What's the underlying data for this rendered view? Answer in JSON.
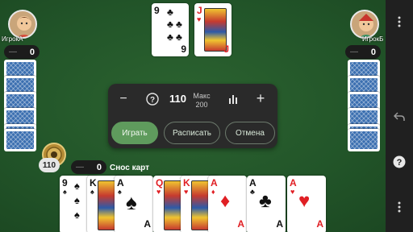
{
  "players": {
    "left": {
      "name": "ИгрокА",
      "score": "0",
      "dash": "—"
    },
    "right": {
      "name": "ИгрокБ",
      "score": "0",
      "dash": "—"
    },
    "me": {
      "score": "0",
      "dash": "—",
      "bid_badge": "110"
    }
  },
  "talon": {
    "cards": [
      {
        "rank": "9",
        "suit": "♣",
        "color": "black"
      },
      {
        "rank": "J",
        "suit": "♥",
        "color": "red"
      }
    ]
  },
  "bid_panel": {
    "minus": "−",
    "help": "?",
    "bid_value": "110",
    "max_label": "Макс",
    "max_value": "200",
    "stats": "stats-icon",
    "plus": "+",
    "buttons": {
      "play": "Играть",
      "write_off": "Расписать",
      "cancel": "Отмена"
    }
  },
  "trash_label": "Снос карт",
  "hand": [
    {
      "rank": "9",
      "suit": "♠",
      "color": "black"
    },
    {
      "rank": "K",
      "suit": "♠",
      "color": "black"
    },
    {
      "rank": "A",
      "suit": "♠",
      "color": "black"
    },
    {
      "rank": "Q",
      "suit": "♥",
      "color": "red"
    },
    {
      "rank": "K",
      "suit": "♥",
      "color": "red"
    },
    {
      "rank": "A",
      "suit": "♦",
      "color": "red"
    },
    {
      "rank": "A",
      "suit": "♣",
      "color": "black"
    },
    {
      "rank": "A",
      "suit": "♥",
      "color": "red"
    }
  ],
  "sidebar": {
    "icons": [
      "more-vert-icon",
      "back-icon",
      "help-icon",
      "more-vert-icon"
    ],
    "help": "?"
  },
  "colors": {
    "felt": "#225529",
    "accent_green": "#5f9b5d",
    "panel": "#2a2a2a",
    "red_suit": "#e01f24"
  }
}
